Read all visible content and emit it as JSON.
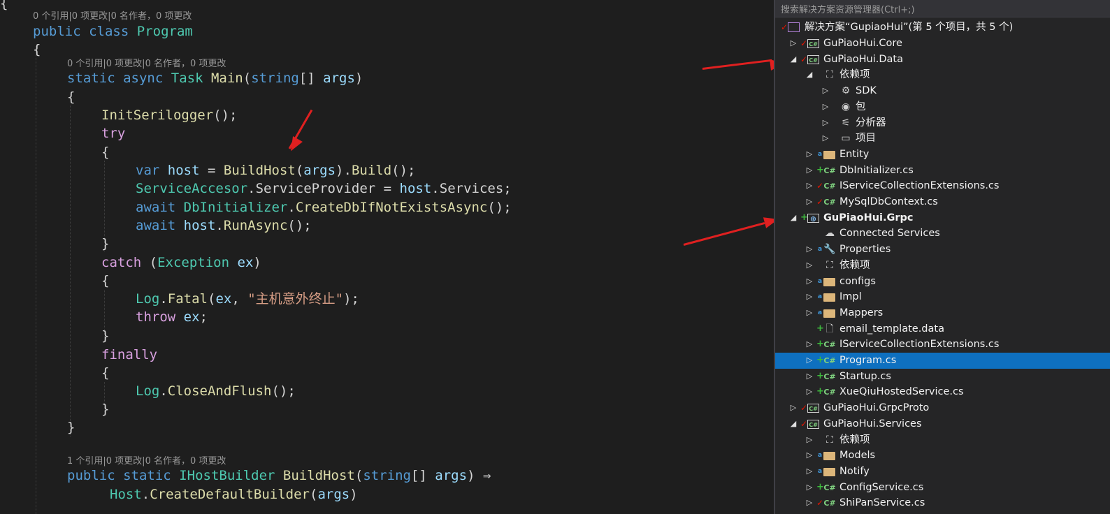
{
  "editor": {
    "lens_class": "0 个引用|0 项更改|0 名作者，0 项更改",
    "lens_main": "0 个引用|0 项更改|0 名作者，0 项更改",
    "lens_buildhost": "1 个引用|0 项更改|0 名作者，0 项更改",
    "top_brace": "{",
    "class_decl": {
      "kw1": "public",
      "kw2": "class",
      "name": "Program"
    },
    "open_brace": "{",
    "close_brace": "}",
    "main_decl": {
      "kw1": "static",
      "kw2": "async",
      "type": "Task",
      "name": "Main",
      "p1": "(",
      "ptype": "string",
      "p2": "[] ",
      "pname": "args",
      "p3": ")"
    },
    "init_call": {
      "fn": "InitSerilogger",
      "rest": "();"
    },
    "try_kw": "try",
    "var_line": {
      "kw": "var",
      "name": "host",
      "eq": " = ",
      "fn": "BuildHost",
      "p1": "(",
      "arg": "args",
      "p2": ").",
      "fn2": "Build",
      "p3": "();"
    },
    "sa_line": {
      "type": "ServiceAccesor",
      "dot": ".",
      "prop": "ServiceProvider",
      "eq": " = ",
      "var": "host",
      "dot2": ".",
      "prop2": "Services",
      "end": ";"
    },
    "await1": {
      "kw": "await",
      "type": "DbInitializer",
      "dot": ".",
      "fn": "CreateDbIfNotExistsAsync",
      "end": "();"
    },
    "await2": {
      "kw": "await",
      "var": "host",
      "dot": ".",
      "fn": "RunAsync",
      "end": "();"
    },
    "catch_line": {
      "kw": "catch",
      "p1": " (",
      "type": "Exception",
      "sp": " ",
      "var": "ex",
      "p2": ")"
    },
    "fatal_line": {
      "type": "Log",
      "dot": ".",
      "fn": "Fatal",
      "p1": "(",
      "var": "ex",
      "comma": ", ",
      "str": "\"主机意外终止\"",
      "end": ");"
    },
    "throw_line": {
      "kw": "throw",
      "sp": " ",
      "var": "ex",
      "end": ";"
    },
    "finally_kw": "finally",
    "close_line": {
      "type": "Log",
      "dot": ".",
      "fn": "CloseAndFlush",
      "end": "();"
    },
    "bh_decl": {
      "kw1": "public",
      "kw2": "static",
      "type": "IHostBuilder",
      "name": "BuildHost",
      "p1": "(",
      "ptype": "string",
      "p2": "[] ",
      "pname": "args",
      "p3": ") ⇒"
    },
    "host_line": {
      "type": "Host",
      "dot": ".",
      "fn": "CreateDefaultBuilder",
      "p1": "(",
      "arg": "args",
      "p2": ")"
    }
  },
  "explorer": {
    "search_placeholder": "搜索解决方案资源管理器(Ctrl+;)",
    "solution_label": "解决方案“GupiaoHui”(第 5 个项目，共 5 个)",
    "nodes": [
      {
        "label": "GuPiaoHui.Core",
        "icon": "project",
        "badge": "check",
        "expander": "collapsed"
      },
      {
        "label": "GuPiaoHui.Data",
        "icon": "project",
        "badge": "check",
        "expander": "expanded"
      },
      {
        "label": "依赖项",
        "icon": "dependencies-icon",
        "badge": "",
        "expander": "expanded"
      },
      {
        "label": "SDK",
        "icon": "sdk-icon",
        "badge": "",
        "expander": "collapsed"
      },
      {
        "label": "包",
        "icon": "package-icon",
        "badge": "",
        "expander": "collapsed"
      },
      {
        "label": "分析器",
        "icon": "analyzer-icon",
        "badge": "",
        "expander": "collapsed"
      },
      {
        "label": "项目",
        "icon": "project-ref-icon",
        "badge": "",
        "expander": "collapsed"
      },
      {
        "label": "Entity",
        "icon": "folder",
        "badge": "lock",
        "expander": "collapsed"
      },
      {
        "label": "DbInitializer.cs",
        "icon": "csharp",
        "badge": "plus",
        "expander": "collapsed"
      },
      {
        "label": "IServiceCollectionExtensions.cs",
        "icon": "csharp",
        "badge": "check",
        "expander": "collapsed"
      },
      {
        "label": "MySqlDbContext.cs",
        "icon": "csharp",
        "badge": "check",
        "expander": "collapsed"
      },
      {
        "label": "GuPiaoHui.Grpc",
        "icon": "web-project",
        "badge": "plus",
        "expander": "expanded"
      },
      {
        "label": "Connected Services",
        "icon": "connected-services-icon",
        "badge": "",
        "expander": "none"
      },
      {
        "label": "Properties",
        "icon": "wrench-icon",
        "badge": "lock",
        "expander": "collapsed"
      },
      {
        "label": "依赖项",
        "icon": "dependencies-icon",
        "badge": "",
        "expander": "collapsed"
      },
      {
        "label": "configs",
        "icon": "folder",
        "badge": "lock",
        "expander": "collapsed"
      },
      {
        "label": "Impl",
        "icon": "folder",
        "badge": "lock",
        "expander": "collapsed"
      },
      {
        "label": "Mappers",
        "icon": "folder",
        "badge": "lock",
        "expander": "collapsed"
      },
      {
        "label": "email_template.data",
        "icon": "file",
        "badge": "plus",
        "expander": "none"
      },
      {
        "label": "IServiceCollectionExtensions.cs",
        "icon": "csharp",
        "badge": "plus",
        "expander": "collapsed"
      },
      {
        "label": "Program.cs",
        "icon": "csharp",
        "badge": "plus",
        "expander": "collapsed",
        "selected": true
      },
      {
        "label": "Startup.cs",
        "icon": "csharp",
        "badge": "plus",
        "expander": "collapsed"
      },
      {
        "label": "XueQiuHostedService.cs",
        "icon": "csharp",
        "badge": "plus",
        "expander": "collapsed"
      },
      {
        "label": "GuPiaoHui.GrpcProto",
        "icon": "project",
        "badge": "check",
        "expander": "collapsed"
      },
      {
        "label": "GuPiaoHui.Services",
        "icon": "project",
        "badge": "check",
        "expander": "expanded"
      },
      {
        "label": "依赖项",
        "icon": "dependencies-icon",
        "badge": "",
        "expander": "collapsed"
      },
      {
        "label": "Models",
        "icon": "folder",
        "badge": "lock",
        "expander": "collapsed"
      },
      {
        "label": "Notify",
        "icon": "folder",
        "badge": "lock",
        "expander": "collapsed"
      },
      {
        "label": "ConfigService.cs",
        "icon": "csharp",
        "badge": "plus",
        "expander": "collapsed"
      },
      {
        "label": "ShiPanService.cs",
        "icon": "csharp",
        "badge": "check",
        "expander": "collapsed"
      }
    ]
  },
  "colors": {
    "annotation_arrow": "#e02020",
    "selection": "#0e70c0"
  }
}
